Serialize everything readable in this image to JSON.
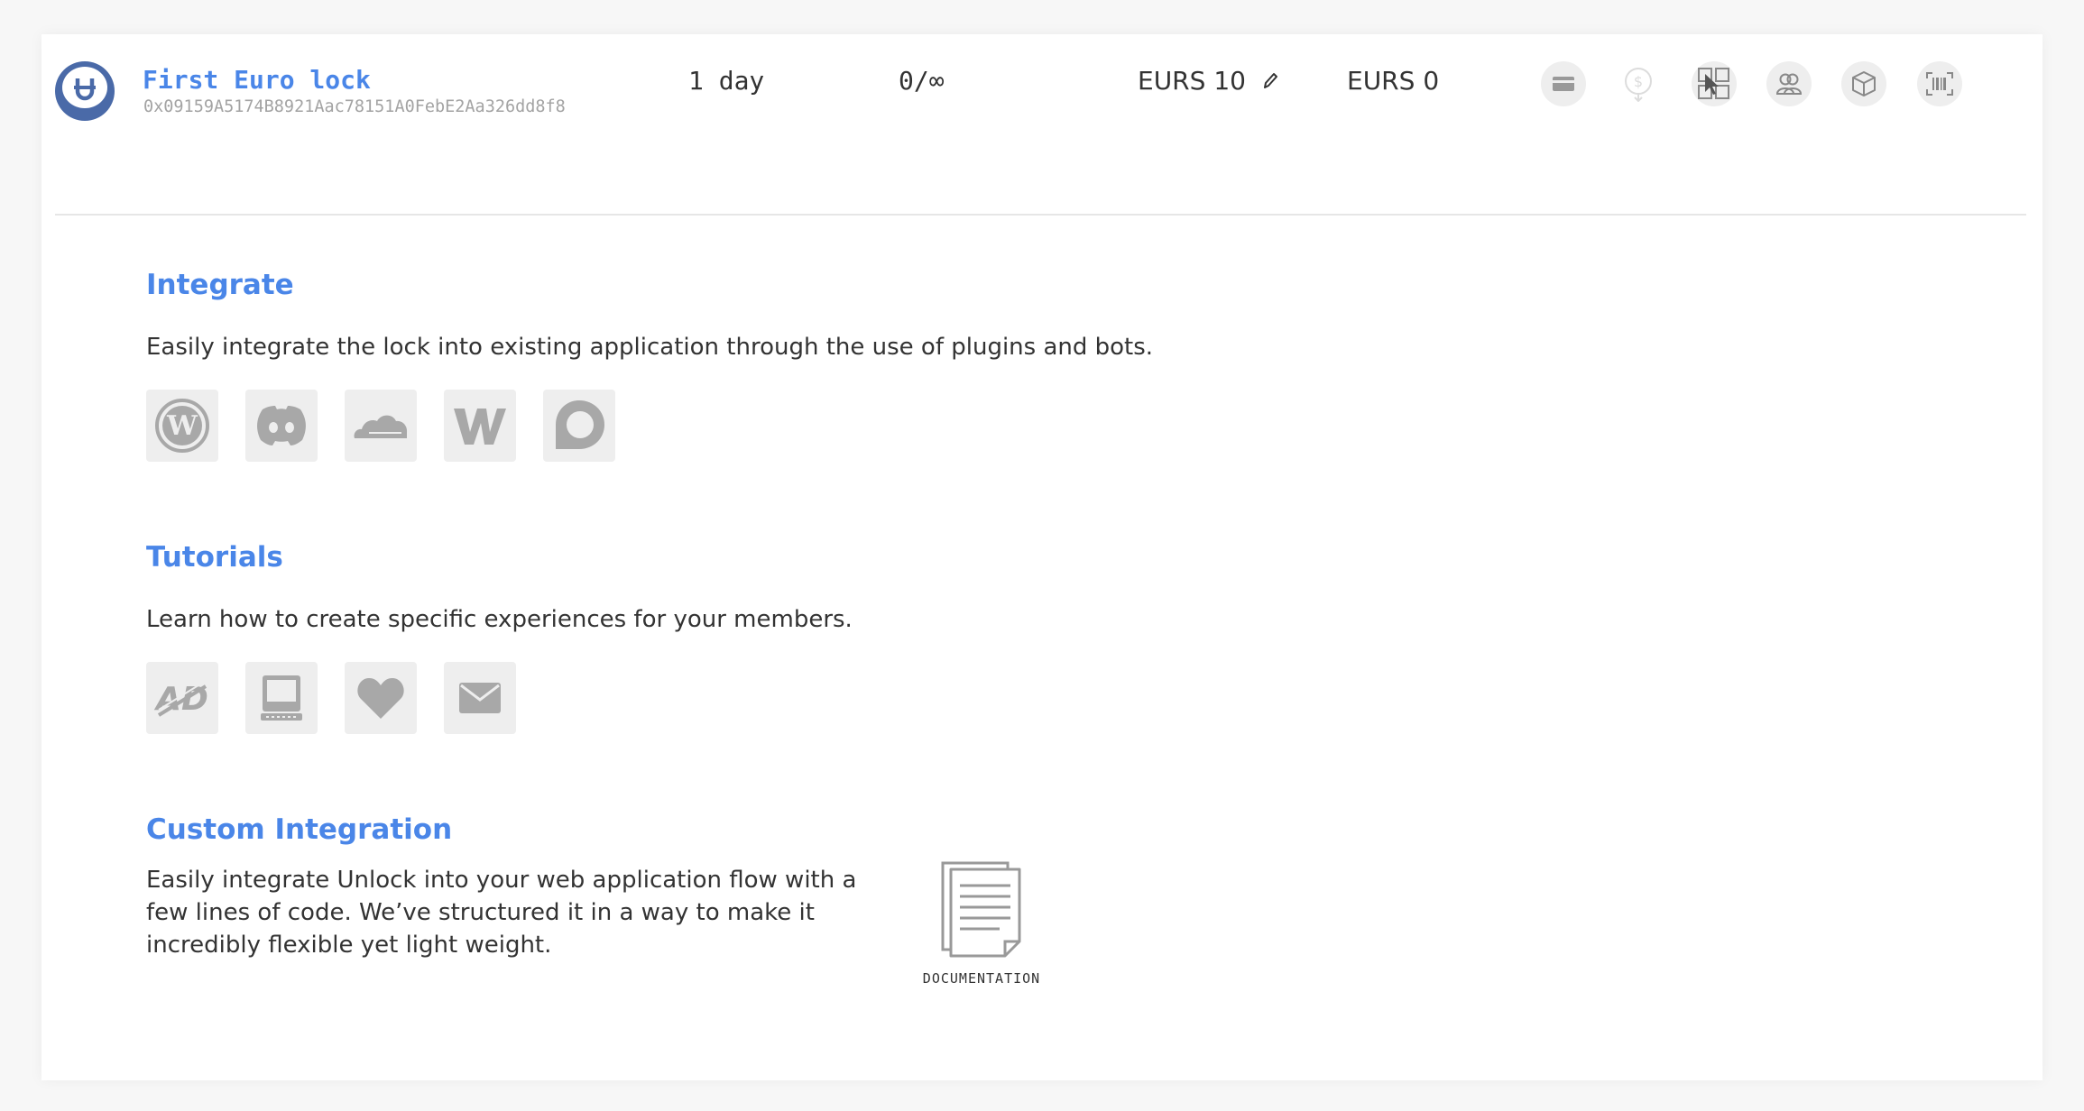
{
  "lock": {
    "name": "First Euro lock",
    "address": "0x09159A5174B8921Aac78151A0FebE2Aa326dd8f8",
    "duration": "1 day",
    "keys": "0/∞",
    "price": "EURS 10",
    "balance": "EURS 0"
  },
  "actions": [
    {
      "icon": "credit-card-icon"
    },
    {
      "icon": "withdraw-icon"
    },
    {
      "icon": "embed-icon"
    },
    {
      "icon": "members-icon"
    },
    {
      "icon": "cube-icon"
    },
    {
      "icon": "barcode-icon"
    }
  ],
  "integrate": {
    "title": "Integrate",
    "description": "Easily integrate the lock into existing application through the use of plugins and bots.",
    "icons": [
      "wordpress-icon",
      "discord-icon",
      "cloudflare-icon",
      "webflow-icon",
      "discourse-icon"
    ]
  },
  "tutorials": {
    "title": "Tutorials",
    "description": "Learn how to create specific experiences for your members.",
    "icons": [
      "ad-free-icon",
      "paywall-icon",
      "donation-icon",
      "newsletter-icon"
    ]
  },
  "custom": {
    "title": "Custom Integration",
    "description": "Easily integrate Unlock into your web application flow with a few lines of code. We’ve structured it in a way to make it incredibly flexible yet light weight.",
    "doc_label": "DOCUMENTATION"
  },
  "colors": {
    "accent": "#4a86e8",
    "lock_icon": "#4a6aa8",
    "icon_gray": "#a8a8a8",
    "tile_bg": "#eeeeee"
  }
}
